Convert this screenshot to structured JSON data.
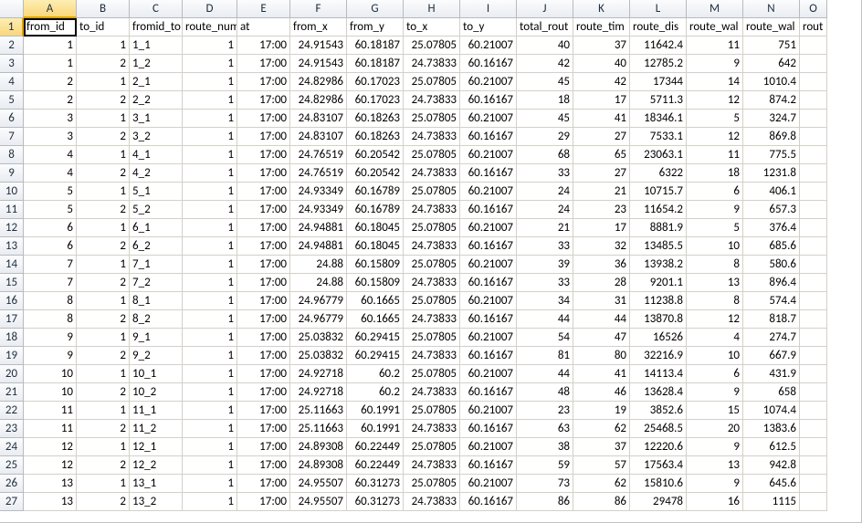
{
  "columns": [
    "A",
    "B",
    "C",
    "D",
    "E",
    "F",
    "G",
    "H",
    "I",
    "J",
    "K",
    "L",
    "M",
    "N",
    "O"
  ],
  "colClasses": [
    "cA",
    "cB",
    "cC",
    "cD",
    "cE",
    "cF",
    "cG",
    "cH",
    "cI",
    "cJ",
    "cK",
    "cL",
    "cM",
    "cN",
    "cO"
  ],
  "selected": {
    "col": 0,
    "row": 0
  },
  "headers": [
    "from_id",
    "to_id",
    "fromid_to",
    "route_num",
    "at",
    "from_x",
    "from_y",
    "to_x",
    "to_y",
    "total_rout",
    "route_tim",
    "route_dis",
    "route_wal",
    "route_wal",
    "rout"
  ],
  "headerAlign": [
    "txt",
    "txt",
    "txt",
    "txt",
    "txt",
    "txt",
    "txt",
    "txt",
    "txt",
    "txt",
    "txt",
    "txt",
    "txt",
    "txt",
    "txt"
  ],
  "dataAlign": [
    "num",
    "num",
    "txt",
    "num",
    "num",
    "num",
    "num",
    "num",
    "num",
    "num",
    "num",
    "num",
    "num",
    "num",
    "num"
  ],
  "rows": [
    [
      "1",
      "1",
      "1_1",
      "1",
      "17:00",
      "24.91543",
      "60.18187",
      "25.07805",
      "60.21007",
      "40",
      "37",
      "11642.4",
      "11",
      "751",
      ""
    ],
    [
      "1",
      "2",
      "1_2",
      "1",
      "17:00",
      "24.91543",
      "60.18187",
      "24.73833",
      "60.16167",
      "42",
      "40",
      "12785.2",
      "9",
      "642",
      ""
    ],
    [
      "2",
      "1",
      "2_1",
      "1",
      "17:00",
      "24.82986",
      "60.17023",
      "25.07805",
      "60.21007",
      "45",
      "42",
      "17344",
      "14",
      "1010.4",
      ""
    ],
    [
      "2",
      "2",
      "2_2",
      "1",
      "17:00",
      "24.82986",
      "60.17023",
      "24.73833",
      "60.16167",
      "18",
      "17",
      "5711.3",
      "12",
      "874.2",
      ""
    ],
    [
      "3",
      "1",
      "3_1",
      "1",
      "17:00",
      "24.83107",
      "60.18263",
      "25.07805",
      "60.21007",
      "45",
      "41",
      "18346.1",
      "5",
      "324.7",
      ""
    ],
    [
      "3",
      "2",
      "3_2",
      "1",
      "17:00",
      "24.83107",
      "60.18263",
      "24.73833",
      "60.16167",
      "29",
      "27",
      "7533.1",
      "12",
      "869.8",
      ""
    ],
    [
      "4",
      "1",
      "4_1",
      "1",
      "17:00",
      "24.76519",
      "60.20542",
      "25.07805",
      "60.21007",
      "68",
      "65",
      "23063.1",
      "11",
      "775.5",
      ""
    ],
    [
      "4",
      "2",
      "4_2",
      "1",
      "17:00",
      "24.76519",
      "60.20542",
      "24.73833",
      "60.16167",
      "33",
      "27",
      "6322",
      "18",
      "1231.8",
      ""
    ],
    [
      "5",
      "1",
      "5_1",
      "1",
      "17:00",
      "24.93349",
      "60.16789",
      "25.07805",
      "60.21007",
      "24",
      "21",
      "10715.7",
      "6",
      "406.1",
      ""
    ],
    [
      "5",
      "2",
      "5_2",
      "1",
      "17:00",
      "24.93349",
      "60.16789",
      "24.73833",
      "60.16167",
      "24",
      "23",
      "11654.2",
      "9",
      "657.3",
      ""
    ],
    [
      "6",
      "1",
      "6_1",
      "1",
      "17:00",
      "24.94881",
      "60.18045",
      "25.07805",
      "60.21007",
      "21",
      "17",
      "8881.9",
      "5",
      "376.4",
      ""
    ],
    [
      "6",
      "2",
      "6_2",
      "1",
      "17:00",
      "24.94881",
      "60.18045",
      "24.73833",
      "60.16167",
      "33",
      "32",
      "13485.5",
      "10",
      "685.6",
      ""
    ],
    [
      "7",
      "1",
      "7_1",
      "1",
      "17:00",
      "24.88",
      "60.15809",
      "25.07805",
      "60.21007",
      "39",
      "36",
      "13938.2",
      "8",
      "580.6",
      ""
    ],
    [
      "7",
      "2",
      "7_2",
      "1",
      "17:00",
      "24.88",
      "60.15809",
      "24.73833",
      "60.16167",
      "33",
      "28",
      "9201.1",
      "13",
      "896.4",
      ""
    ],
    [
      "8",
      "1",
      "8_1",
      "1",
      "17:00",
      "24.96779",
      "60.1665",
      "25.07805",
      "60.21007",
      "34",
      "31",
      "11238.8",
      "8",
      "574.4",
      ""
    ],
    [
      "8",
      "2",
      "8_2",
      "1",
      "17:00",
      "24.96779",
      "60.1665",
      "24.73833",
      "60.16167",
      "44",
      "44",
      "13870.8",
      "12",
      "818.7",
      ""
    ],
    [
      "9",
      "1",
      "9_1",
      "1",
      "17:00",
      "25.03832",
      "60.29415",
      "25.07805",
      "60.21007",
      "54",
      "47",
      "16526",
      "4",
      "274.7",
      ""
    ],
    [
      "9",
      "2",
      "9_2",
      "1",
      "17:00",
      "25.03832",
      "60.29415",
      "24.73833",
      "60.16167",
      "81",
      "80",
      "32216.9",
      "10",
      "667.9",
      ""
    ],
    [
      "10",
      "1",
      "10_1",
      "1",
      "17:00",
      "24.92718",
      "60.2",
      "25.07805",
      "60.21007",
      "44",
      "41",
      "14113.4",
      "6",
      "431.9",
      ""
    ],
    [
      "10",
      "2",
      "10_2",
      "1",
      "17:00",
      "24.92718",
      "60.2",
      "24.73833",
      "60.16167",
      "48",
      "46",
      "13628.4",
      "9",
      "658",
      ""
    ],
    [
      "11",
      "1",
      "11_1",
      "1",
      "17:00",
      "25.11663",
      "60.1991",
      "25.07805",
      "60.21007",
      "23",
      "19",
      "3852.6",
      "15",
      "1074.4",
      ""
    ],
    [
      "11",
      "2",
      "11_2",
      "1",
      "17:00",
      "25.11663",
      "60.1991",
      "24.73833",
      "60.16167",
      "63",
      "62",
      "25468.5",
      "20",
      "1383.6",
      ""
    ],
    [
      "12",
      "1",
      "12_1",
      "1",
      "17:00",
      "24.89308",
      "60.22449",
      "25.07805",
      "60.21007",
      "38",
      "37",
      "12220.6",
      "9",
      "612.5",
      ""
    ],
    [
      "12",
      "2",
      "12_2",
      "1",
      "17:00",
      "24.89308",
      "60.22449",
      "24.73833",
      "60.16167",
      "59",
      "57",
      "17563.4",
      "13",
      "942.8",
      ""
    ],
    [
      "13",
      "1",
      "13_1",
      "1",
      "17:00",
      "24.95507",
      "60.31273",
      "25.07805",
      "60.21007",
      "73",
      "62",
      "15810.6",
      "9",
      "645.6",
      ""
    ],
    [
      "13",
      "2",
      "13_2",
      "1",
      "17:00",
      "24.95507",
      "60.31273",
      "24.73833",
      "60.16167",
      "86",
      "86",
      "29478",
      "16",
      "1115",
      ""
    ]
  ]
}
